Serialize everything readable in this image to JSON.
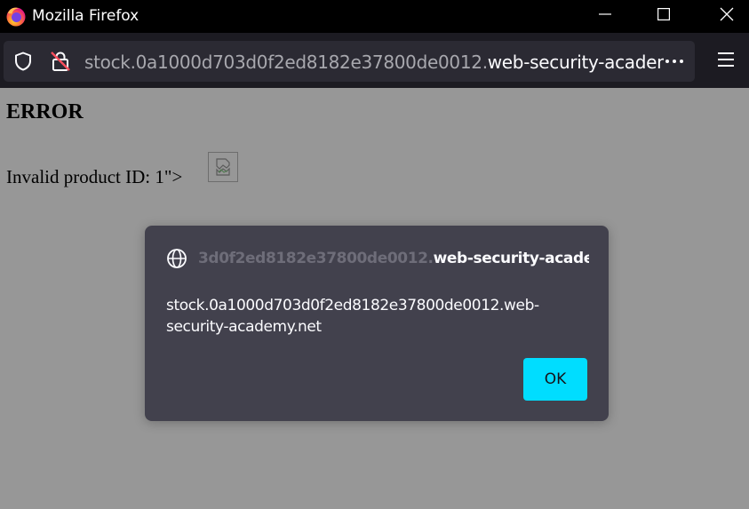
{
  "window": {
    "title": "Mozilla Firefox"
  },
  "icons": {
    "app": "firefox-logo-icon",
    "minimize": "minimize-icon",
    "maximize": "maximize-icon",
    "close": "close-icon",
    "tracking": "shield-icon",
    "security": "insecure-lock-icon",
    "more": "more-horizontal-icon",
    "menu": "hamburger-menu-icon",
    "broken_image": "broken-image-icon",
    "dialog_origin": "globe-icon"
  },
  "toolbar": {
    "url_prefix": "stock.0a1000d703d0f2ed8182e37800de0012.",
    "url_domain": "web-security-academy.ne"
  },
  "page": {
    "heading": "ERROR",
    "message": "Invalid product ID: 1\">"
  },
  "dialog": {
    "title_faded": "3d0f2ed8182e37800de0012.",
    "title_main": "web-security-academy.net",
    "message": "stock.0a1000d703d0f2ed8182e37800de0012.web-security-academy.net",
    "ok_label": "OK"
  },
  "colors": {
    "titlebar": "#000000",
    "toolbar": "#1c1b22",
    "urlbar": "#2b2a33",
    "page_overlay": "#979797",
    "dialog": "#42414d",
    "accent": "#00ddff"
  }
}
